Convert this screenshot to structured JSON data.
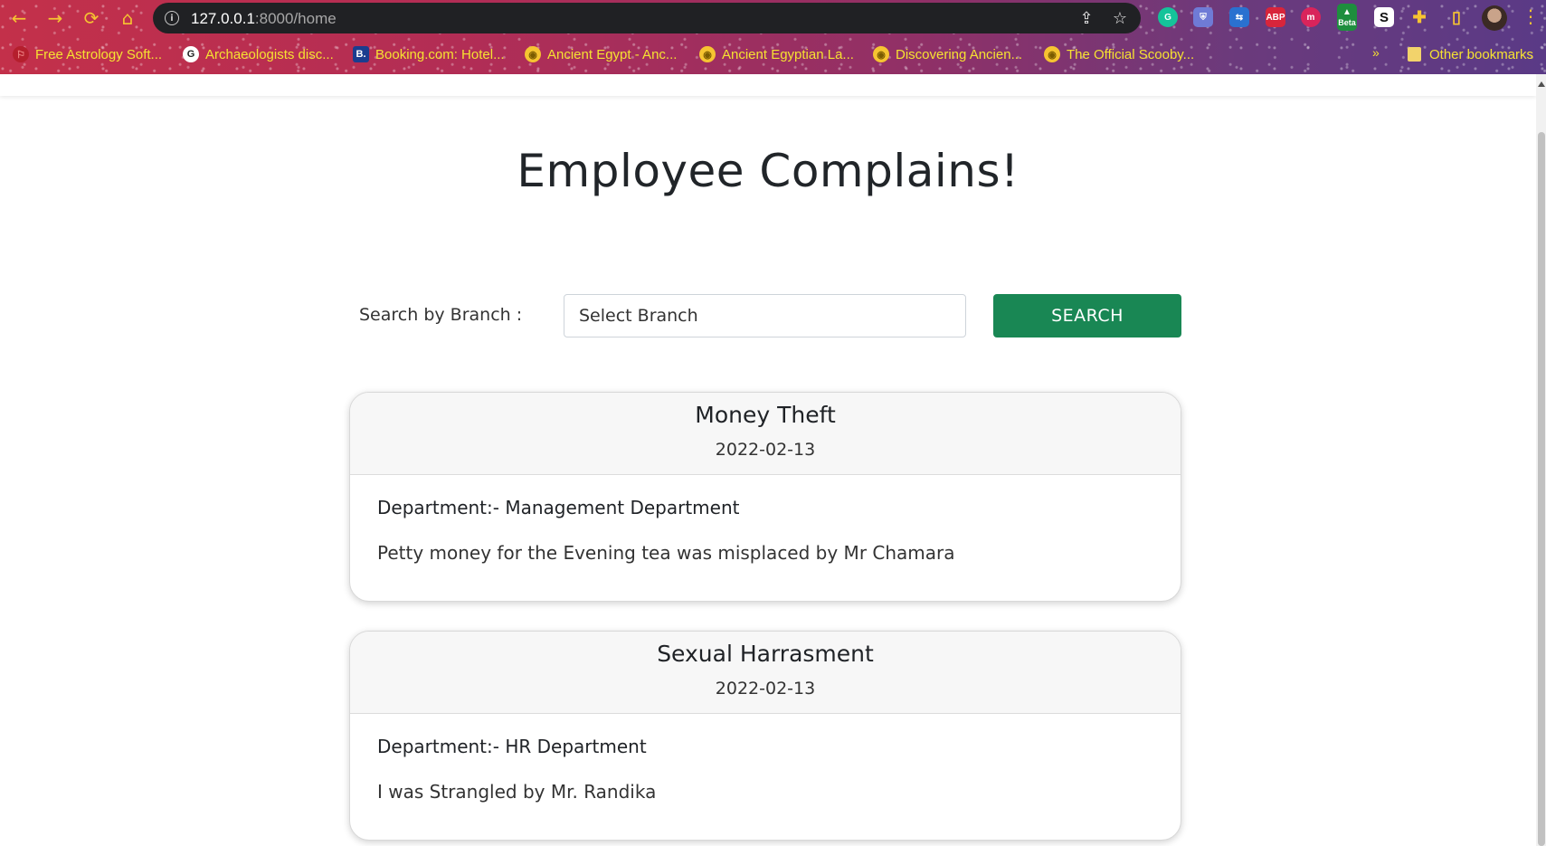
{
  "browser": {
    "url_host": "127.0.0.1",
    "url_path": ":8000/home",
    "nav": {
      "back_icon": "←",
      "forward_icon": "→",
      "reload_icon": "⟳",
      "home_icon": "⌂"
    },
    "extensions": [
      {
        "name": "grammarly-icon",
        "label": "G",
        "color": "#15c39a"
      },
      {
        "name": "shield-extension-icon",
        "label": "⛨",
        "color": "#6f7bd6"
      },
      {
        "name": "translate-extension-icon",
        "label": "⇆",
        "color": "#2a71d0"
      },
      {
        "name": "adblock-plus-icon",
        "label": "ABP",
        "color": "#d8253b"
      },
      {
        "name": "m-extension-icon",
        "label": "m",
        "color": "#d9245b"
      },
      {
        "name": "beta-extension-icon",
        "label": "▲",
        "color": "#1e8e3e",
        "tag": "Beta"
      },
      {
        "name": "s-extension-icon",
        "label": "S",
        "color": "#111111"
      },
      {
        "name": "puzzle-extensions-icon",
        "label": "✚",
        "color": "#f6c431"
      },
      {
        "name": "sidepanel-icon",
        "label": "▯",
        "color": "#f6c431"
      }
    ],
    "bookmarks": [
      {
        "name": "bookmark-free-astrology",
        "label": "Free Astrology Soft...",
        "icon_text": "⚐",
        "icon_bg": "#b51f2d",
        "icon_color": "#f28a8a"
      },
      {
        "name": "bookmark-archaeologists",
        "label": "Archaeologists disc...",
        "icon_text": "G",
        "icon_bg": "#ffffff",
        "icon_color": "#222222"
      },
      {
        "name": "bookmark-booking",
        "label": "Booking.com: Hotel...",
        "icon_text": "B.",
        "icon_bg": "#1a3d8f",
        "icon_color": "#ffffff"
      },
      {
        "name": "bookmark-ancient-egypt",
        "label": "Ancient Egypt - Anc...",
        "icon_text": "◉",
        "icon_bg": "#f6c431",
        "icon_color": "#7a5b00"
      },
      {
        "name": "bookmark-ancient-egyptian-la",
        "label": "Ancient Egyptian La...",
        "icon_text": "◉",
        "icon_bg": "#f6c431",
        "icon_color": "#7a5b00"
      },
      {
        "name": "bookmark-discovering-ancien",
        "label": "Discovering Ancien...",
        "icon_text": "◉",
        "icon_bg": "#f6c431",
        "icon_color": "#7a5b00"
      },
      {
        "name": "bookmark-official-scooby",
        "label": "The Official Scooby...",
        "icon_text": "◉",
        "icon_bg": "#f6c431",
        "icon_color": "#7a5b00"
      }
    ],
    "more_bookmarks": "»",
    "other_bookmarks": "Other bookmarks"
  },
  "page": {
    "title": "Employee Complains!",
    "search": {
      "label": "Search by Branch :",
      "placeholder": "Select Branch",
      "button": "SEARCH"
    },
    "complaints": [
      {
        "title": "Money Theft",
        "date": "2022-02-13",
        "department": "Department:- Management Department",
        "description": "Petty money for the Evening tea was misplaced by Mr Chamara"
      },
      {
        "title": "Sexual Harrasment",
        "date": "2022-02-13",
        "department": "Department:- HR Department",
        "description": "I was Strangled by Mr. Randika"
      }
    ]
  }
}
